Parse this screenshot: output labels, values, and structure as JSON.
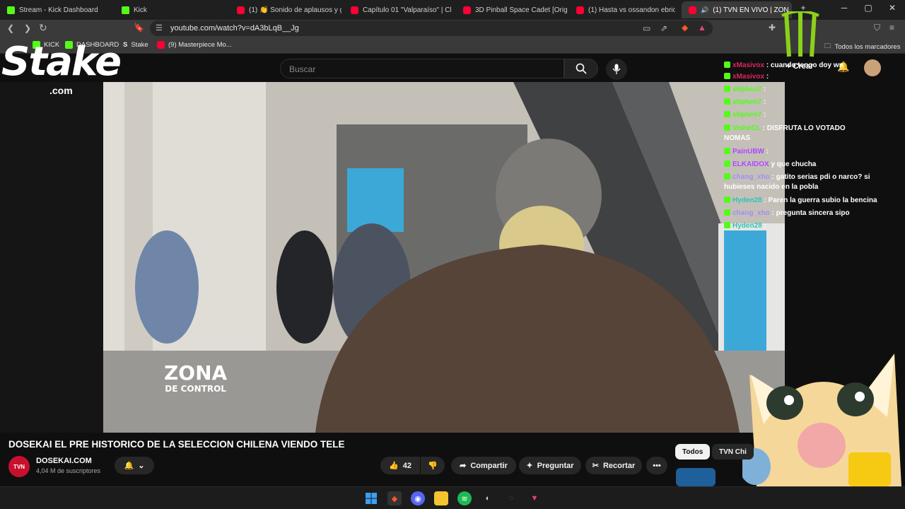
{
  "tabs": [
    {
      "label": "Stream - Kick Dashboard",
      "icon": "kick-icon"
    },
    {
      "label": "Kick",
      "icon": "kick-icon"
    },
    {
      "label": "(1) 👏 Sonido de aplausos y g",
      "icon": "youtube-icon"
    },
    {
      "label": "Capítulo 01 \"Valparaíso\" | Chile",
      "icon": "youtube-icon"
    },
    {
      "label": "3D Pinball Space Cadet [Origin",
      "icon": "youtube-icon"
    },
    {
      "label": "(1) Hasta vs ossandon ebrios",
      "icon": "youtube-icon"
    },
    {
      "label": "(1) TVN EN VIVO | ZON",
      "icon": "youtube-icon"
    }
  ],
  "address": {
    "url": "youtube.com/watch?v=dA3bLqB__Jg"
  },
  "bookmarks": [
    {
      "label": "KICK"
    },
    {
      "label": "DASHBOARD"
    },
    {
      "label": "Stake"
    },
    {
      "label": "(9) Masterpiece Mo..."
    }
  ],
  "bookmarks_all": "Todos los marcadores",
  "youtube": {
    "search_placeholder": "Buscar",
    "create_label": "Crear"
  },
  "overlay": {
    "stake_logo": "Stake",
    "stake_com": ".com",
    "zona_line1": "ZONA",
    "zona_line2": "DE CONTROL"
  },
  "chat": [
    {
      "user": "xMasivox",
      "text": ": cuando tengo doy wn",
      "color": "#e0245e"
    },
    {
      "user": "xMasivox",
      "text": ":",
      "color": "#e0245e"
    },
    {
      "user": "stiphen7",
      "text": ":",
      "color": "#53fc18"
    },
    {
      "user": "stiphen7",
      "text": ":",
      "color": "#53fc18"
    },
    {
      "user": "stiphen7",
      "text": ":",
      "color": "#53fc18"
    },
    {
      "user": "VisheCL",
      "text": ": DISFRUTA LO VOTADO",
      "color": "#53fc18"
    },
    {
      "user": "",
      "text": "NOMAS",
      "color": "#ffffff"
    },
    {
      "user": "PainUBW",
      "text": ":",
      "color": "#b146ff"
    },
    {
      "user": "ELKAIDOX",
      "text": "y que chucha",
      "color": "#b146ff"
    },
    {
      "user": "chang_xho",
      "text": ": gatito serias pdi o narco? si",
      "color": "#a78bfa"
    },
    {
      "user": "",
      "text": "hubieses nacido en la pobla",
      "color": "#ffffff"
    },
    {
      "user": "Hyden28",
      "text": ": Paren la guerra subio la bencina",
      "color": "#2ec4b6"
    },
    {
      "user": "chang_xho",
      "text": ": pregunta sincera sipo",
      "color": "#a78bfa"
    },
    {
      "user": "Hyden28",
      "text": ":",
      "color": "#2ec4b6"
    }
  ],
  "video": {
    "title": "DOSEKAI EL PRE HISTORICO DE LA SELECCION CHILENA VIENDO TELE",
    "channel": "DOSEKAI.COM",
    "subscribers": "4,04 M de suscriptores",
    "avatar_text": "TVN",
    "likes": "42",
    "share_label": "Compartir",
    "ask_label": "Preguntar",
    "clip_label": "Recortar"
  },
  "chips": [
    {
      "label": "Todos"
    },
    {
      "label": "TVN Chi"
    }
  ],
  "colors": {
    "kick_green": "#53fc18",
    "youtube_red": "#ff0033",
    "page_bg": "#0f0f0f"
  }
}
